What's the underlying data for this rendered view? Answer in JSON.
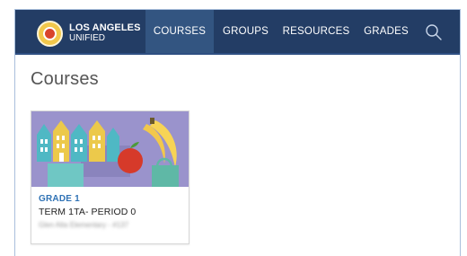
{
  "header": {
    "logo": {
      "line1": "LOS ANGELES",
      "line2": "UNIFIED"
    },
    "nav": [
      {
        "label": "COURSES",
        "active": true
      },
      {
        "label": "GROUPS",
        "active": false
      },
      {
        "label": "RESOURCES",
        "active": false
      },
      {
        "label": "GRADES",
        "active": false
      }
    ],
    "search_icon": "search-icon"
  },
  "main": {
    "title": "Courses",
    "courses": [
      {
        "grade": "GRADE 1",
        "name": "TERM 1TA- PERIOD 0",
        "school": "Glen Alta Elementary - #137"
      }
    ]
  },
  "colors": {
    "navbar": "#233d65",
    "nav_active": "#335581",
    "accent_link": "#2f72b5",
    "card_bg": "#9a93cc"
  }
}
